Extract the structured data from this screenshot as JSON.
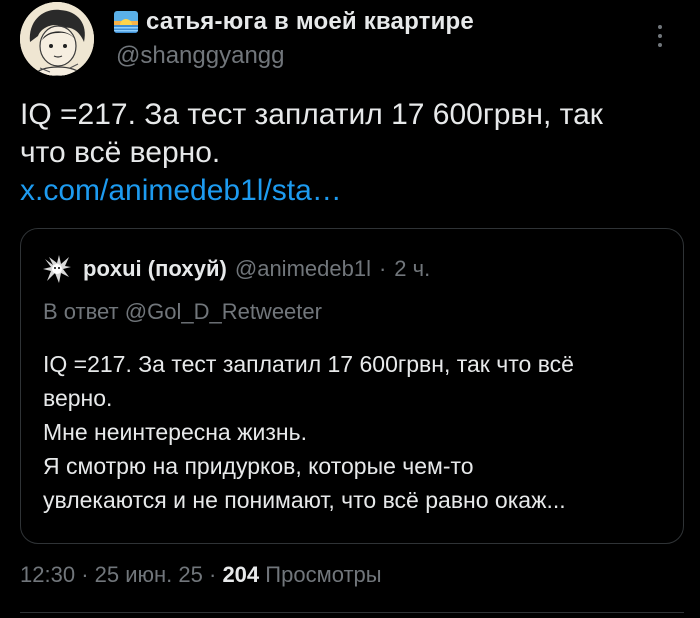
{
  "author": {
    "display_name": "сатья-юга в моей квартире",
    "handle": "@shanggyangg",
    "badge_icon": "sunrise-emoji-icon",
    "avatar_icon": "anime-avatar-icon"
  },
  "post": {
    "text_lines": [
      "IQ =217. За тест заплатил 17 600грвн, так",
      "что всё верно."
    ],
    "link": "x.com/animedeb1l/sta…",
    "more_icon": "more-vertical-icon"
  },
  "quote": {
    "display_name": "poxui (похуй)",
    "handle": "@animedeb1l",
    "separator": "·",
    "time": "2 ч.",
    "reply_label": "В ответ",
    "reply_mention": "@Gol_D_Retweeter",
    "text_lines": [
      "IQ =217. За тест заплатил 17 600грвн, так что всё",
      "верно.",
      "Мне неинтересна жизнь.",
      "Я смотрю на придурков, которые чем-то",
      "увлекаются и не понимают, что всё равно окаж..."
    ]
  },
  "meta": {
    "time": "12:30",
    "sep1": "·",
    "date": "25 июн. 25",
    "sep2": "·",
    "views_count": "204",
    "views_label": "Просмотры"
  },
  "colors": {
    "background": "#000000",
    "text": "#e7e9ea",
    "secondary": "#71767b",
    "link": "#1d9bf0",
    "border": "#2f3336"
  }
}
